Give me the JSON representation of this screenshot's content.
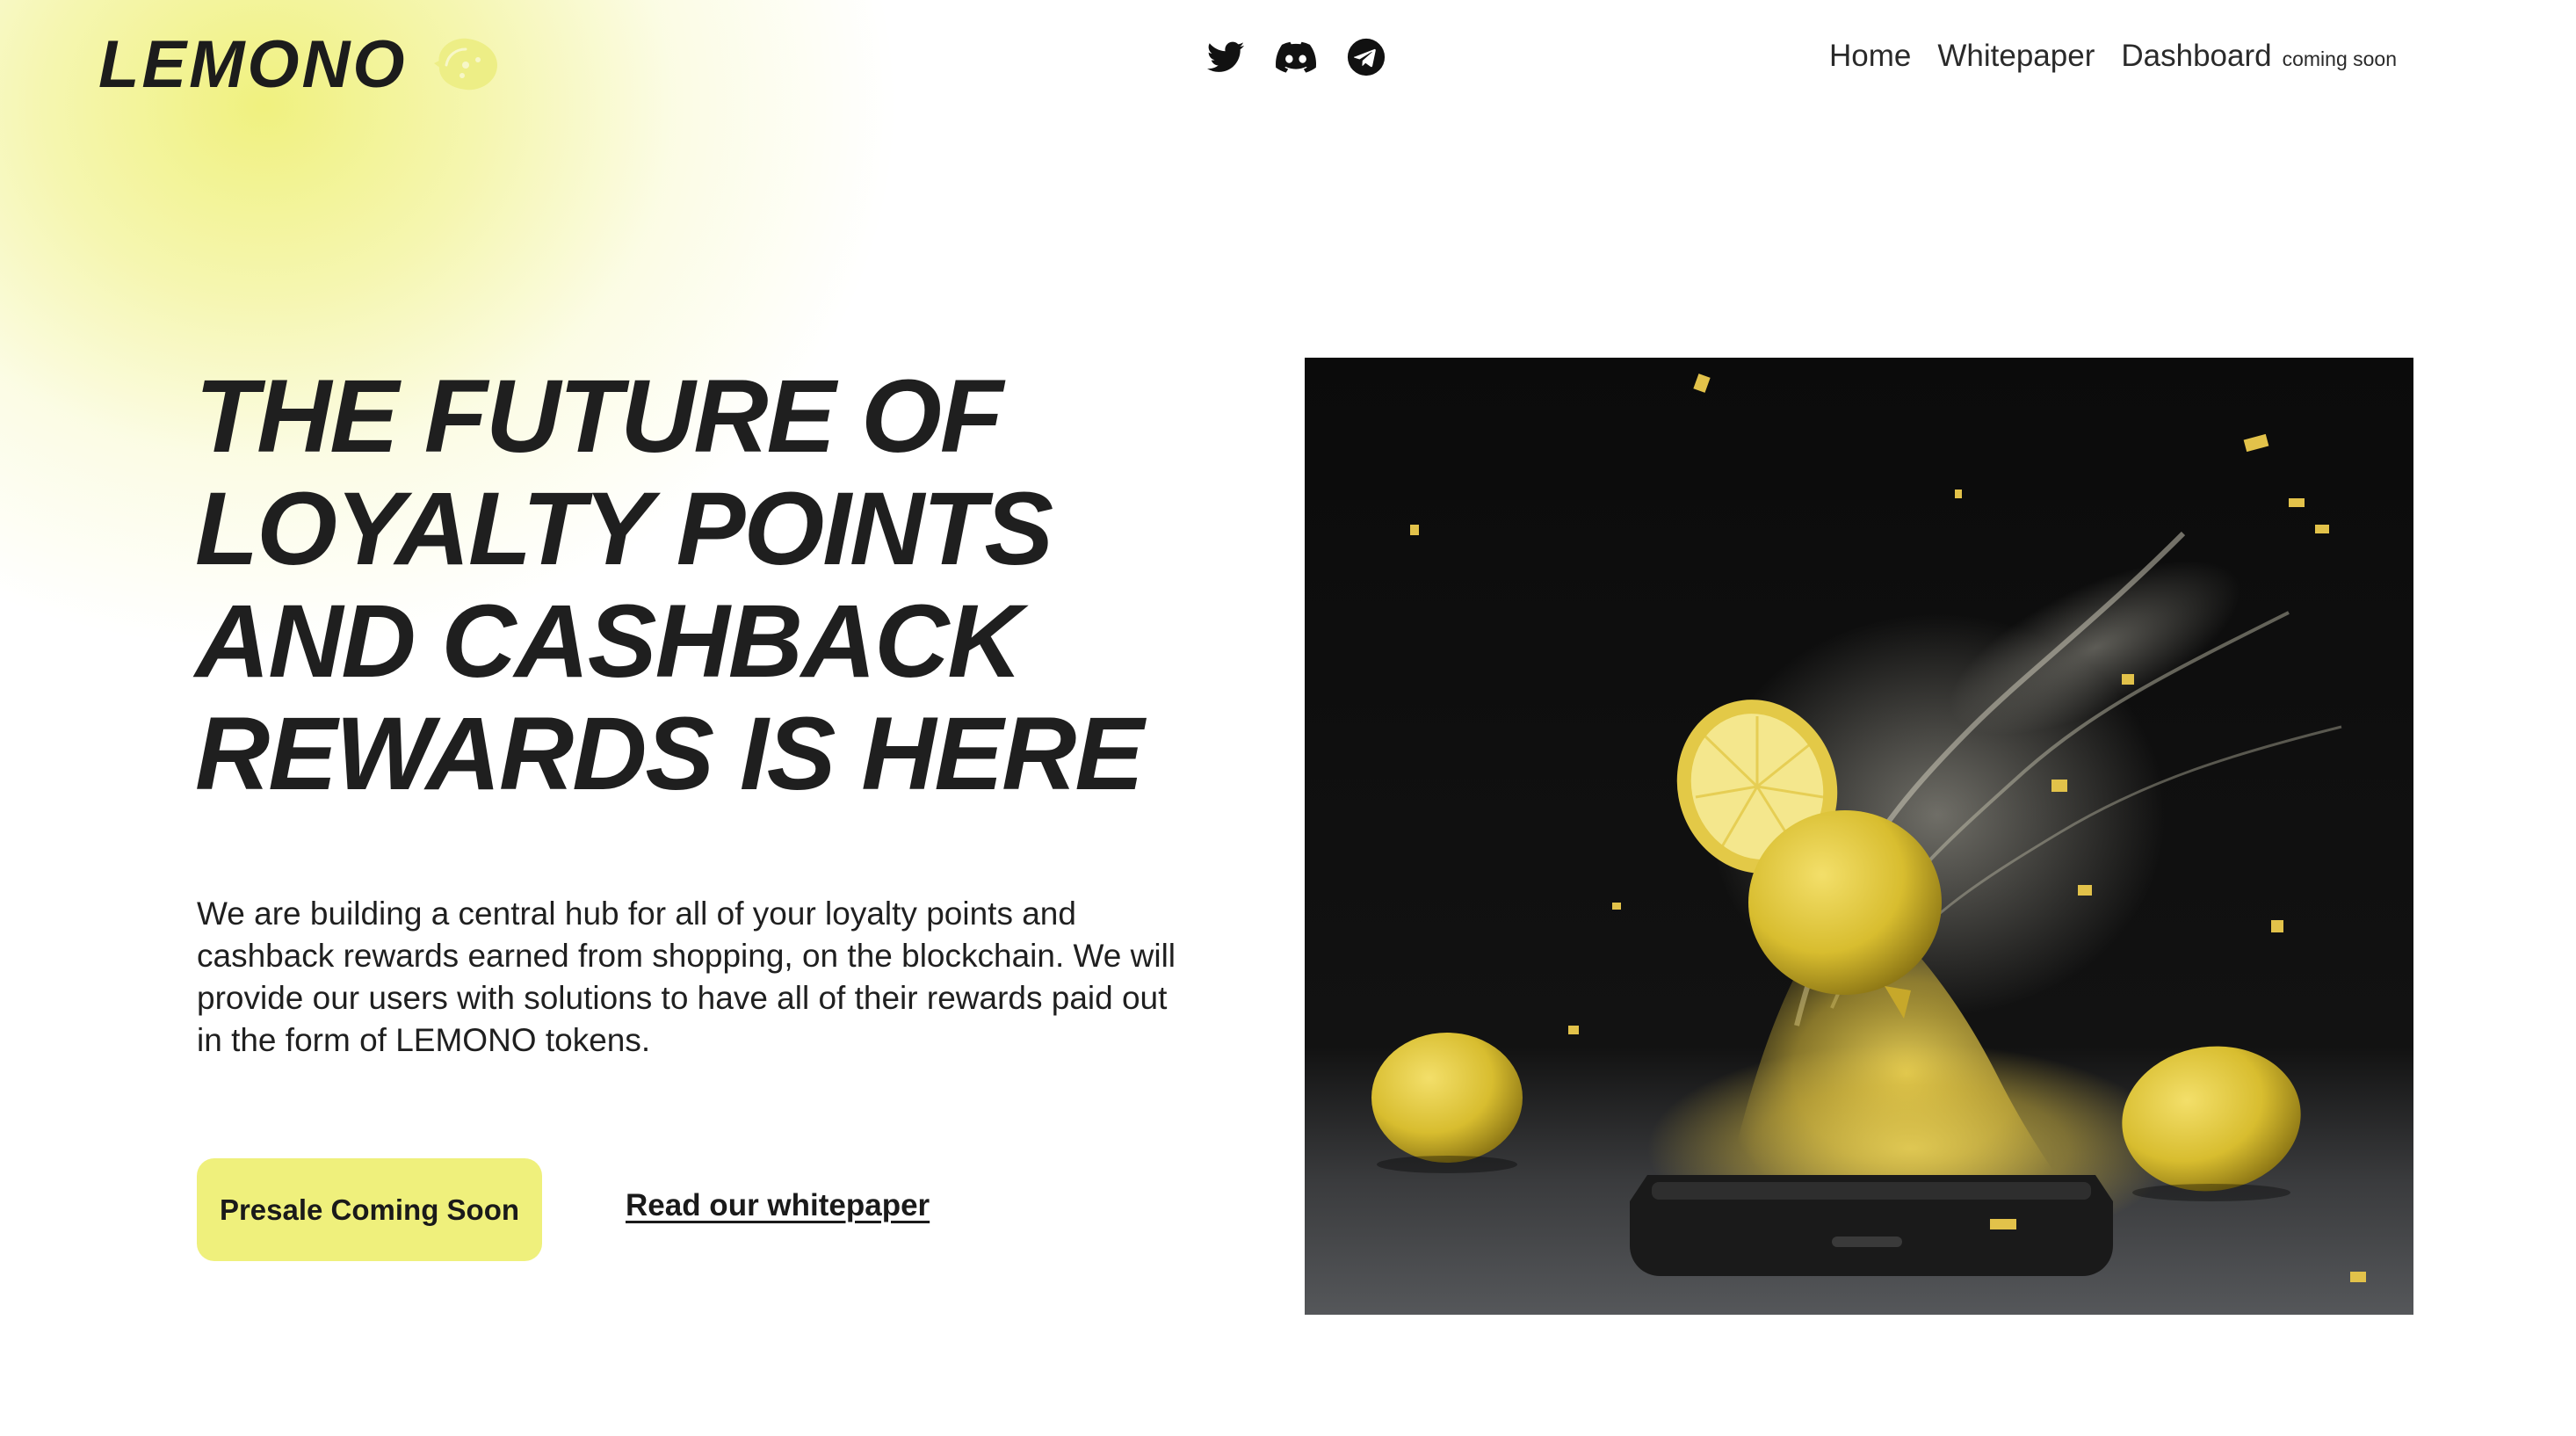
{
  "brand": {
    "name": "LEMONO",
    "logo_icon": "lemon-icon",
    "accent_color": "#EFF07C",
    "text_color": "#1F1F1F"
  },
  "social": [
    {
      "name": "twitter",
      "icon": "twitter-icon"
    },
    {
      "name": "discord",
      "icon": "discord-icon"
    },
    {
      "name": "telegram",
      "icon": "telegram-icon"
    }
  ],
  "nav": {
    "home": "Home",
    "whitepaper": "Whitepaper",
    "dashboard": "Dashboard",
    "dashboard_badge": "coming soon"
  },
  "hero": {
    "headline_lines": [
      "THE FUTURE OF",
      "LOYALTY POINTS",
      "AND CASHBACK",
      "REWARDS IS HERE"
    ],
    "description": "We are building a central hub for all of your loyalty points and cashback rewards earned from shopping, on the blockchain. We will provide our users with solutions to have all of their rewards paid out in the form of LEMONO tokens.",
    "cta_primary": "Presale Coming Soon",
    "cta_secondary": "Read our whitepaper",
    "image_subject": "lemons-splashing-over-smartphone-photo"
  }
}
